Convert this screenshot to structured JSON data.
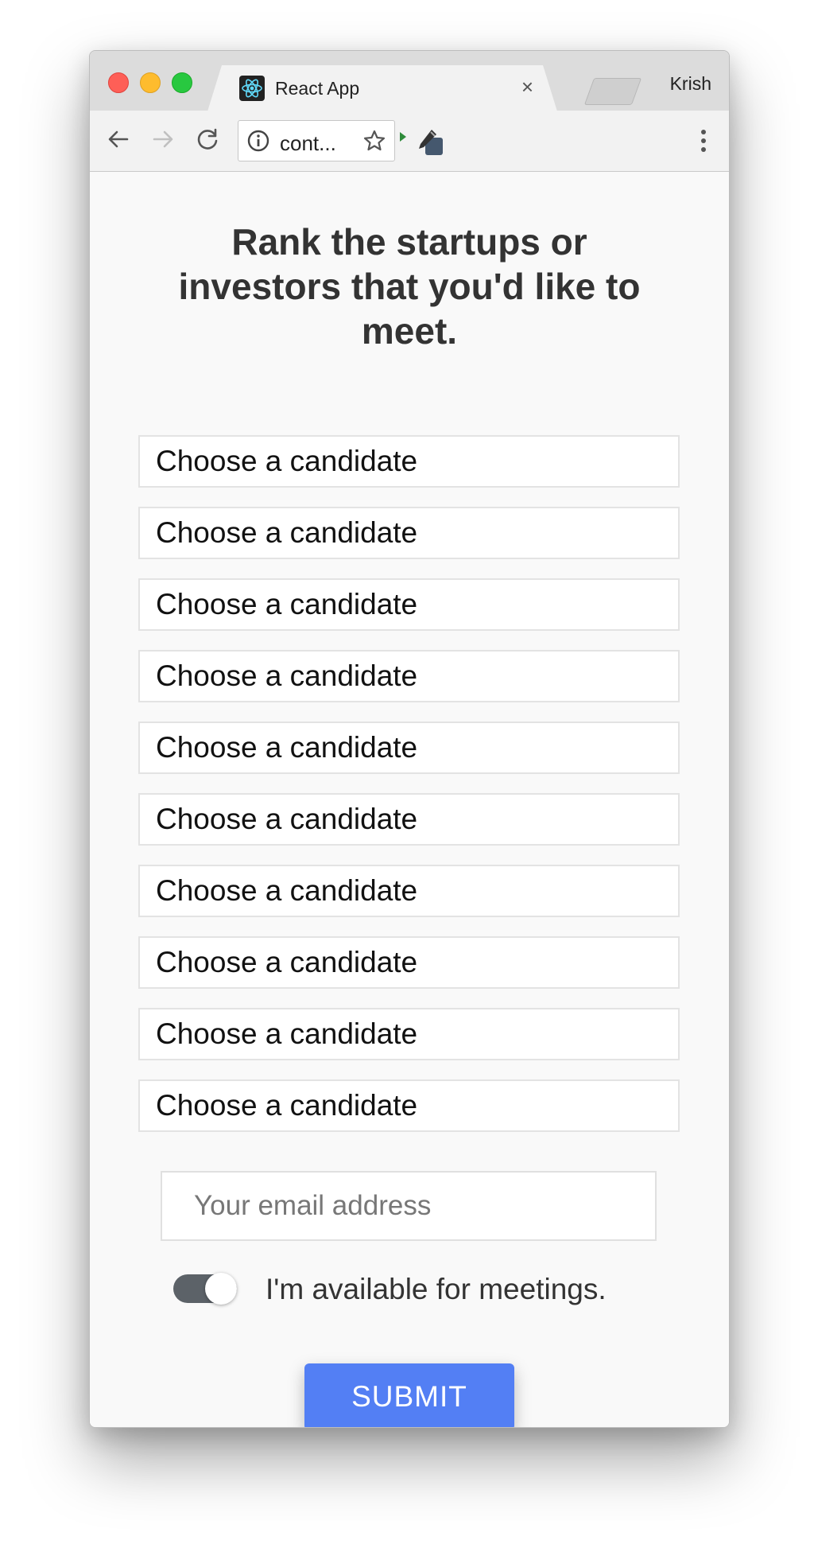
{
  "browser": {
    "tab_title": "React App",
    "tab_close": "×",
    "profile_name": "Krish",
    "address_text": "cont..."
  },
  "form": {
    "heading": "Rank the startups or investors that you'd like to meet.",
    "candidate_placeholder": "Choose a candidate",
    "candidate_slots": 10,
    "email_placeholder": "Your email address",
    "availability_label": "I'm available for meetings.",
    "availability_on": true,
    "submit_label": "SUBMIT"
  },
  "colors": {
    "submit": "#537ff4",
    "toggle_track": "#5c6268",
    "heading": "#333333"
  },
  "icons": [
    "react-logo-icon",
    "back-arrow-icon",
    "forward-arrow-icon",
    "reload-icon",
    "info-icon",
    "star-icon",
    "eyedropper-icon",
    "more-vert-icon"
  ]
}
